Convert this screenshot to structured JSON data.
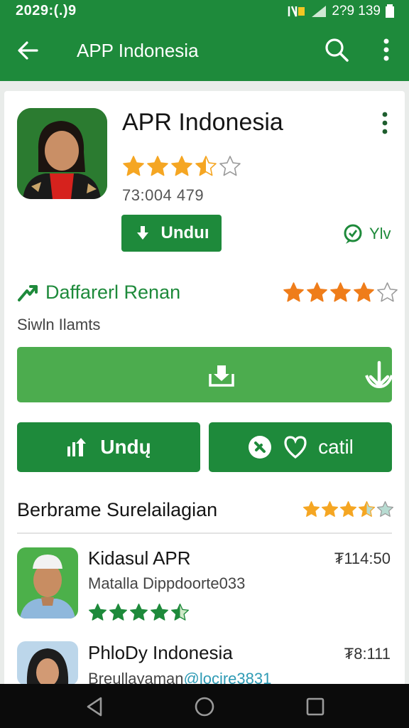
{
  "status_bar": {
    "time": "2029:(.)9",
    "right_text": "2?9 139"
  },
  "toolbar": {
    "title": "APP Indonesia"
  },
  "app": {
    "name": "APR Indonesia",
    "rating": 3.5,
    "count": "73:004 479",
    "install_label": "Unduı",
    "share_label": "Ylv"
  },
  "review": {
    "title": "Daffarerl Renan",
    "subtitle": "Siwln Ilamts",
    "rating": 4
  },
  "actions": {
    "left_label": "Undų",
    "right_label": "catil"
  },
  "section": {
    "title": "Berbrame Surelailagian",
    "rating": 3.5
  },
  "items": [
    {
      "name": "Kidasul APR",
      "subtitle": "Matalla Dippdoorte033",
      "price": "₮114:50",
      "rating": 4.5
    },
    {
      "name": "PhloDy Indonesia",
      "subtitle_a": "Breullayaman",
      "subtitle_b": "@locire3831",
      "price": "₮8:111"
    }
  ],
  "colors": {
    "primary": "#1e8a3b",
    "primary_light": "#4cac4e",
    "star": "#f5a623",
    "star_orange": "#ef7d1a",
    "star_green": "#1e8a3b",
    "navbar": "#0b0b0b"
  },
  "icons": [
    "back-arrow-icon",
    "search-icon",
    "overflow-menu-icon",
    "download-icon",
    "chat-icon",
    "trend-icon",
    "share-icon",
    "heart-icon",
    "back-nav-icon",
    "home-nav-icon",
    "recents-nav-icon"
  ]
}
